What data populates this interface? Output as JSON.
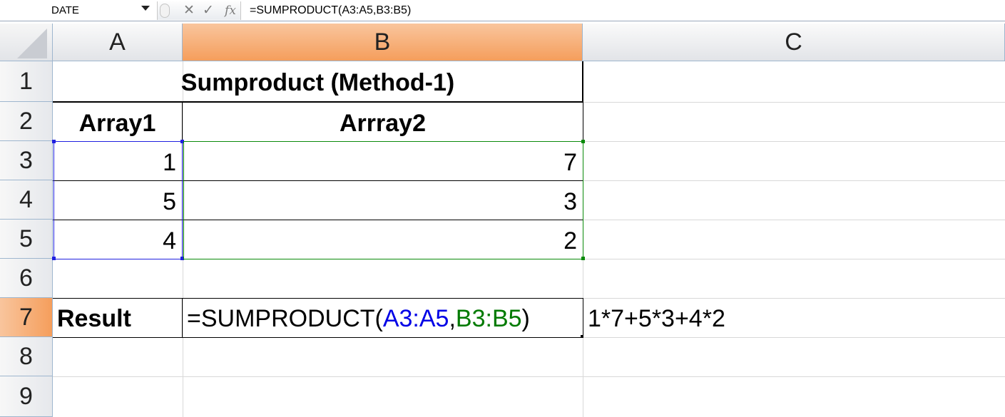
{
  "formula_bar": {
    "name_box": "DATE",
    "cancel_icon": "✕",
    "enter_icon": "✓",
    "fx_icon": "fx",
    "formula": "=SUMPRODUCT(A3:A5,B3:B5)"
  },
  "columns": [
    "A",
    "B",
    "C"
  ],
  "active_column": "B",
  "rows": [
    "1",
    "2",
    "3",
    "4",
    "5",
    "6",
    "7",
    "8",
    "9"
  ],
  "active_row": "7",
  "cells": {
    "title": "Sumproduct (Method-1)",
    "header_a": "Array1",
    "header_b": "Arrray2",
    "a3": "1",
    "b3": "7",
    "a4": "5",
    "b4": "3",
    "a5": "4",
    "b5": "2",
    "a7": "Result",
    "b7": {
      "prefix": "=SUMPRODUCT(",
      "ref1": "A3:A5",
      "sep": ",",
      "ref2": "B3:B5",
      "suffix": ")"
    },
    "c7": "1*7+5*3+4*2"
  },
  "colors": {
    "ref1": "#0000e6",
    "ref2": "#007a00",
    "active_header": "#f59e5c"
  }
}
